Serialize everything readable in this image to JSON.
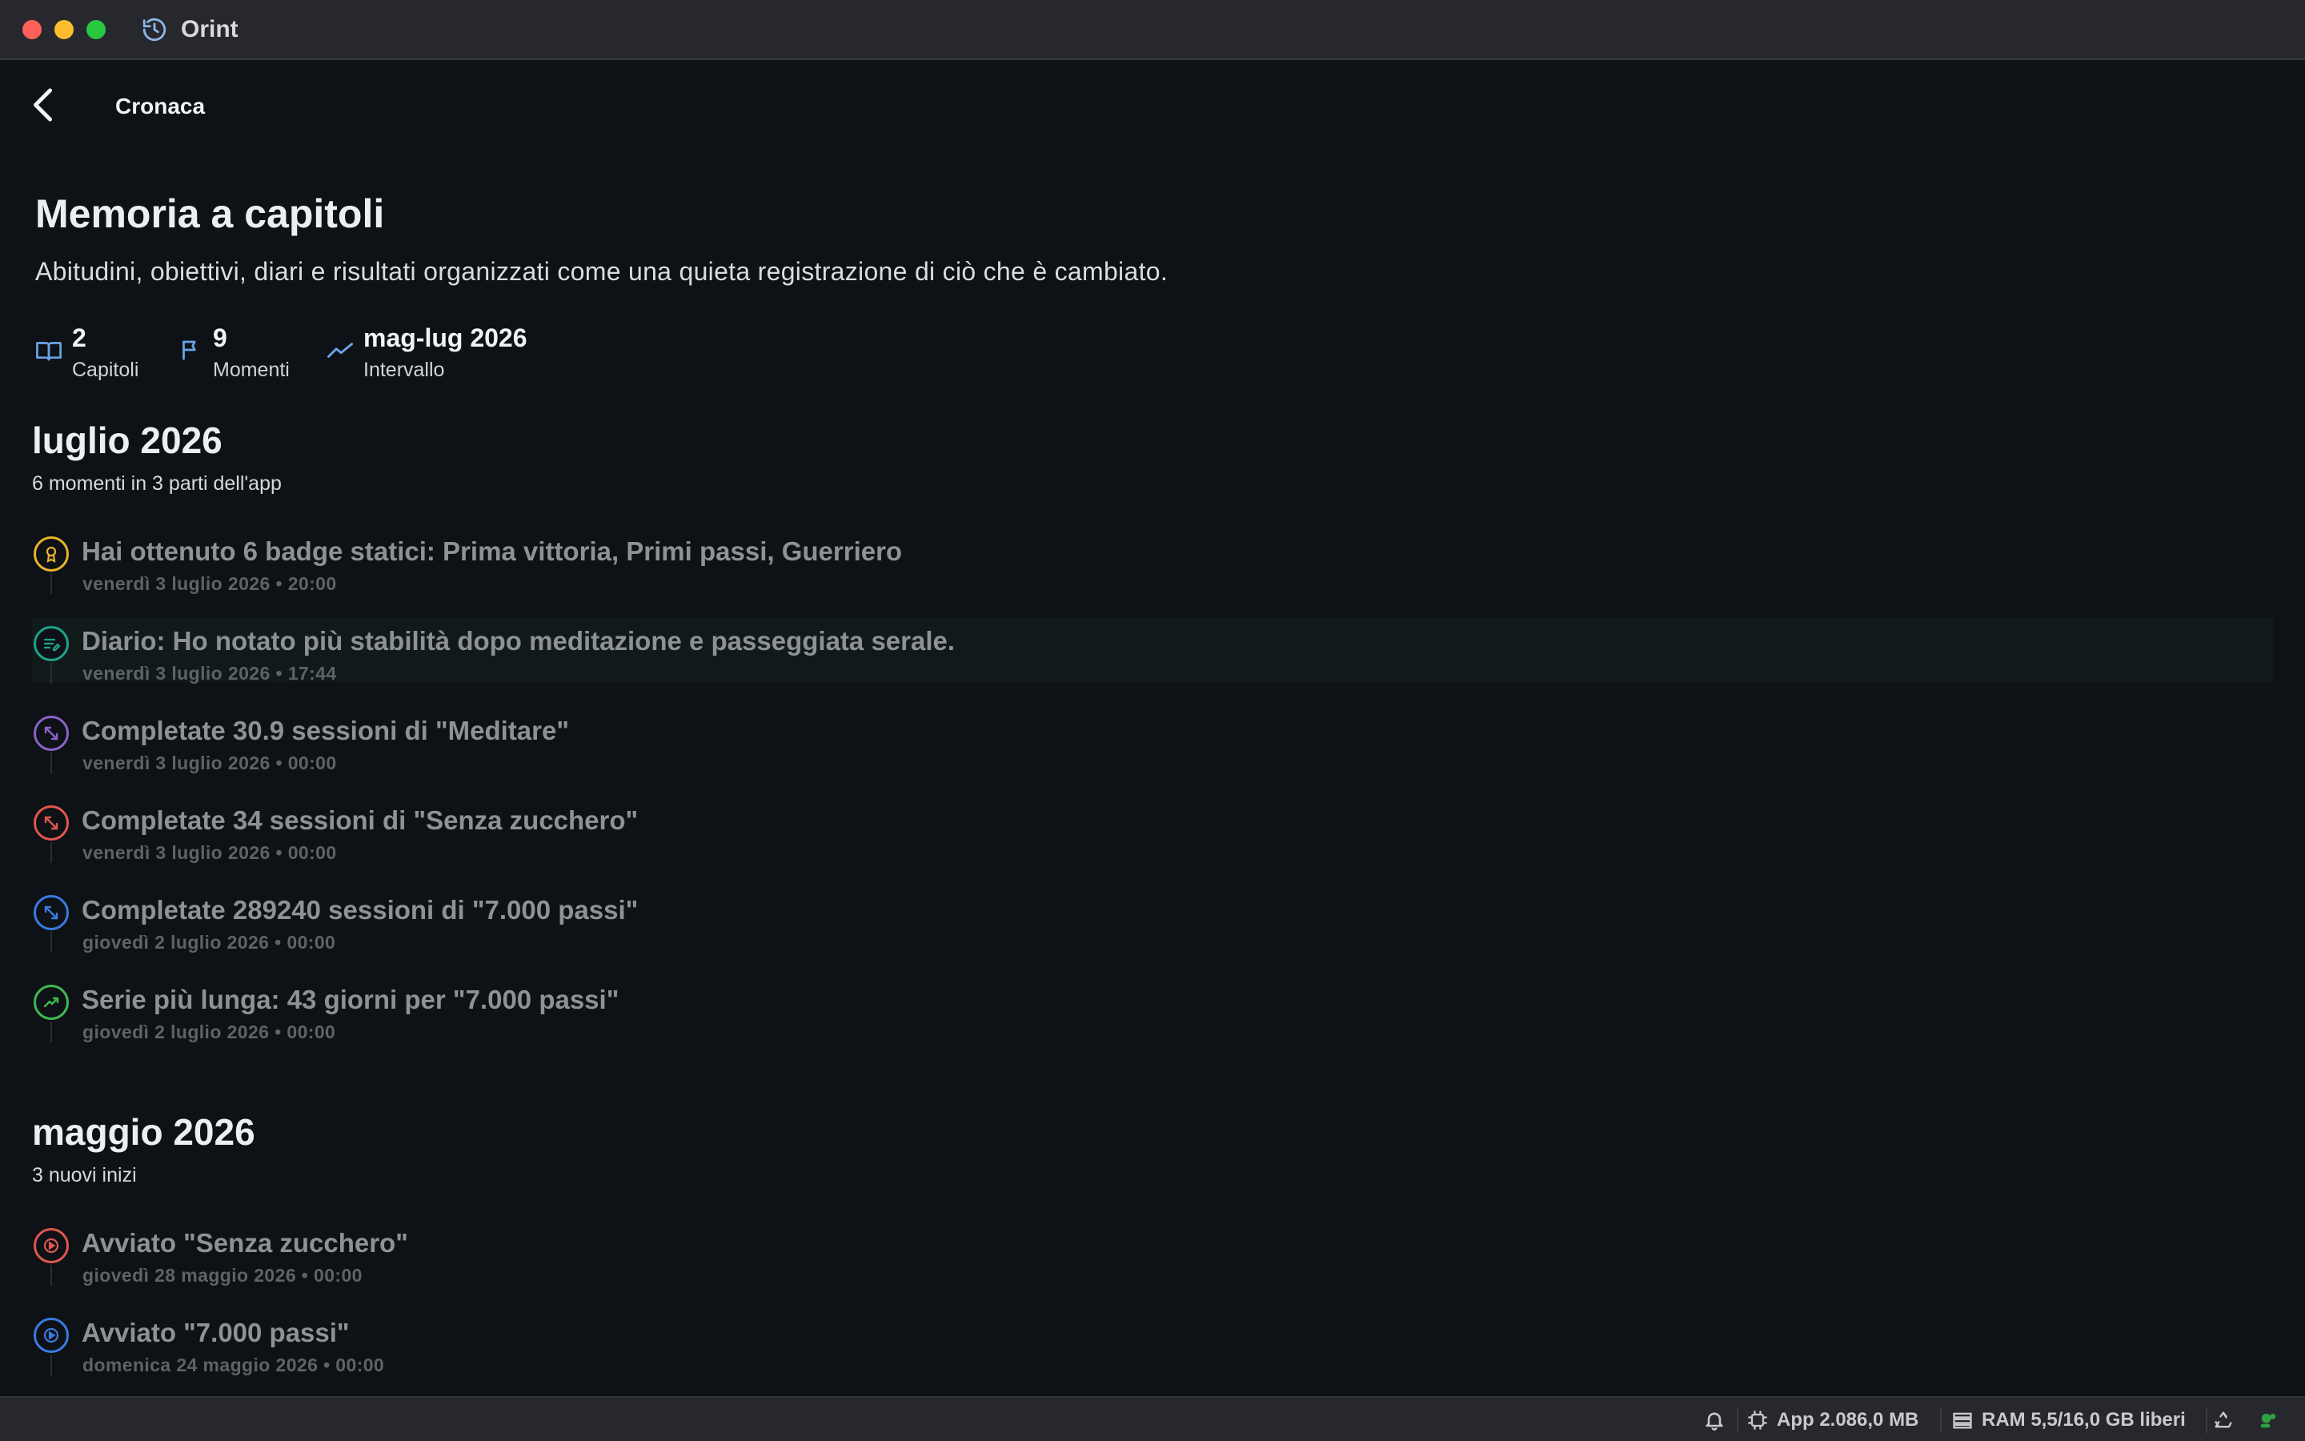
{
  "window": {
    "app_title": "Orint"
  },
  "nav": {
    "title": "Cronaca"
  },
  "header": {
    "title": "Memoria a capitoli",
    "subtitle": "Abitudini, obiettivi, diari e risultati organizzati come una quieta registrazione di ciò che è cambiato."
  },
  "stats": [
    {
      "value": "2",
      "label": "Capitoli",
      "icon": "book-icon"
    },
    {
      "value": "9",
      "label": "Momenti",
      "icon": "flag-icon"
    },
    {
      "value": "mag-lug 2026",
      "label": "Intervallo",
      "icon": "trend-icon"
    }
  ],
  "months": [
    {
      "title": "luglio 2026",
      "subtitle": "6 momenti in 3 parti dell'app",
      "events": [
        {
          "title": "Hai ottenuto 6 badge statici: Prima vittoria, Primi passi, Guerriero",
          "date": "venerdì 3 luglio 2026 • 20:00",
          "icon": "badge-icon",
          "color": "#e7b52b"
        },
        {
          "title": "Diario: Ho notato più stabilità dopo meditazione e passeggiata serale.",
          "date": "venerdì 3 luglio 2026 • 17:44",
          "icon": "journal-icon",
          "color": "#1fa38a"
        },
        {
          "title": "Completate 30.9 sessioni di \"Meditare\"",
          "date": "venerdì 3 luglio 2026 • 00:00",
          "icon": "expand-icon",
          "color": "#8a63c9"
        },
        {
          "title": "Completate 34 sessioni di \"Senza zucchero\"",
          "date": "venerdì 3 luglio 2026 • 00:00",
          "icon": "expand-icon",
          "color": "#e0574f"
        },
        {
          "title": "Completate 289240 sessioni di \"7.000 passi\"",
          "date": "giovedì 2 luglio 2026 • 00:00",
          "icon": "expand-icon",
          "color": "#3a7be0"
        },
        {
          "title": "Serie più lunga: 43 giorni per \"7.000 passi\"",
          "date": "giovedì 2 luglio 2026 • 00:00",
          "icon": "trend-icon",
          "color": "#3fb950"
        }
      ]
    },
    {
      "title": "maggio 2026",
      "subtitle": "3 nuovi inizi",
      "events": [
        {
          "title": "Avviato \"Senza zucchero\"",
          "date": "giovedì 28 maggio 2026 • 00:00",
          "icon": "play-icon",
          "color": "#e0574f"
        },
        {
          "title": "Avviato \"7.000 passi\"",
          "date": "domenica 24 maggio 2026 • 00:00",
          "icon": "play-icon",
          "color": "#3a7be0"
        }
      ]
    }
  ],
  "statusbar": {
    "app_memory": "App 2.086,0 MB",
    "ram": "RAM 5,5/16,0 GB liberi"
  },
  "colors": {
    "background": "#0e1116",
    "titlebar": "#26282d",
    "accent_blue": "#6aa3e6"
  }
}
